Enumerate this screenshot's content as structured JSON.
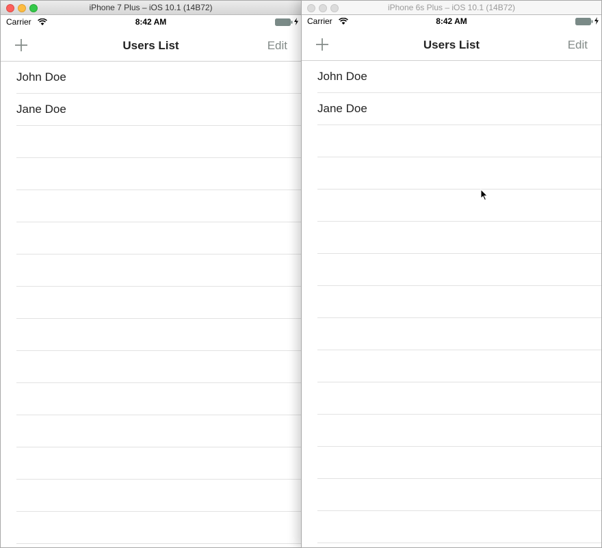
{
  "windows": [
    {
      "title": "iPhone 7 Plus – iOS 10.1 (14B72)",
      "active": true,
      "status": {
        "carrier": "Carrier",
        "time": "8:42 AM"
      },
      "nav": {
        "title": "Users List",
        "edit_label": "Edit"
      },
      "users": [
        "John Doe",
        "Jane Doe"
      ]
    },
    {
      "title": "iPhone 6s Plus – iOS 10.1 (14B72)",
      "active": false,
      "status": {
        "carrier": "Carrier",
        "time": "8:42 AM"
      },
      "nav": {
        "title": "Users List",
        "edit_label": "Edit"
      },
      "users": [
        "John Doe",
        "Jane Doe"
      ]
    }
  ],
  "colors": {
    "tint": "#828a87",
    "separator": "#e2e2e2",
    "battery": "#7a8a87"
  },
  "icons": {
    "add": "plus-icon",
    "wifi": "wifi-icon",
    "battery": "battery-icon",
    "charging": "lightning-bolt-icon",
    "cursor": "mouse-pointer-icon"
  }
}
